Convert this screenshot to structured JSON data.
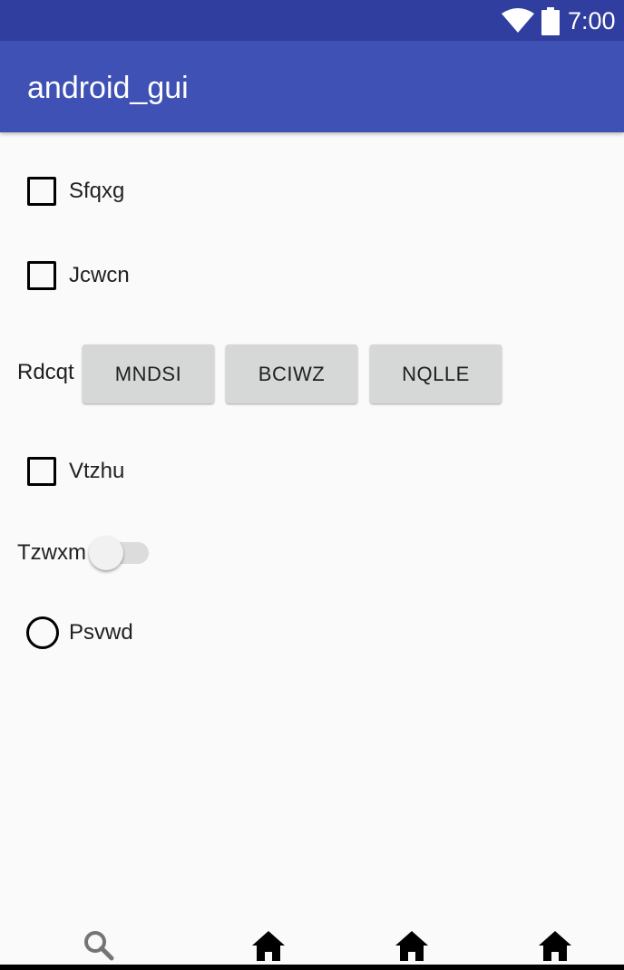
{
  "status_bar": {
    "time": "7:00",
    "icons": [
      "wifi-icon",
      "battery-icon"
    ],
    "color": "#303f9f"
  },
  "app_bar": {
    "title": "android_gui",
    "color": "#3f51b5"
  },
  "checkboxes": [
    {
      "label": "Sfqxg",
      "checked": false
    },
    {
      "label": "Jcwcn",
      "checked": false
    },
    {
      "label": "Vtzhu",
      "checked": false
    }
  ],
  "button_group": {
    "label": "Rdcqt",
    "buttons": [
      "MNDSI",
      "BCIWZ",
      "NQLLE"
    ]
  },
  "switch": {
    "label": "Tzwxm",
    "on": false
  },
  "radio": {
    "label": "Psvwd",
    "selected": false
  },
  "bottom_nav": {
    "items": [
      "search-icon",
      "home-icon",
      "home-icon",
      "home-icon"
    ]
  }
}
